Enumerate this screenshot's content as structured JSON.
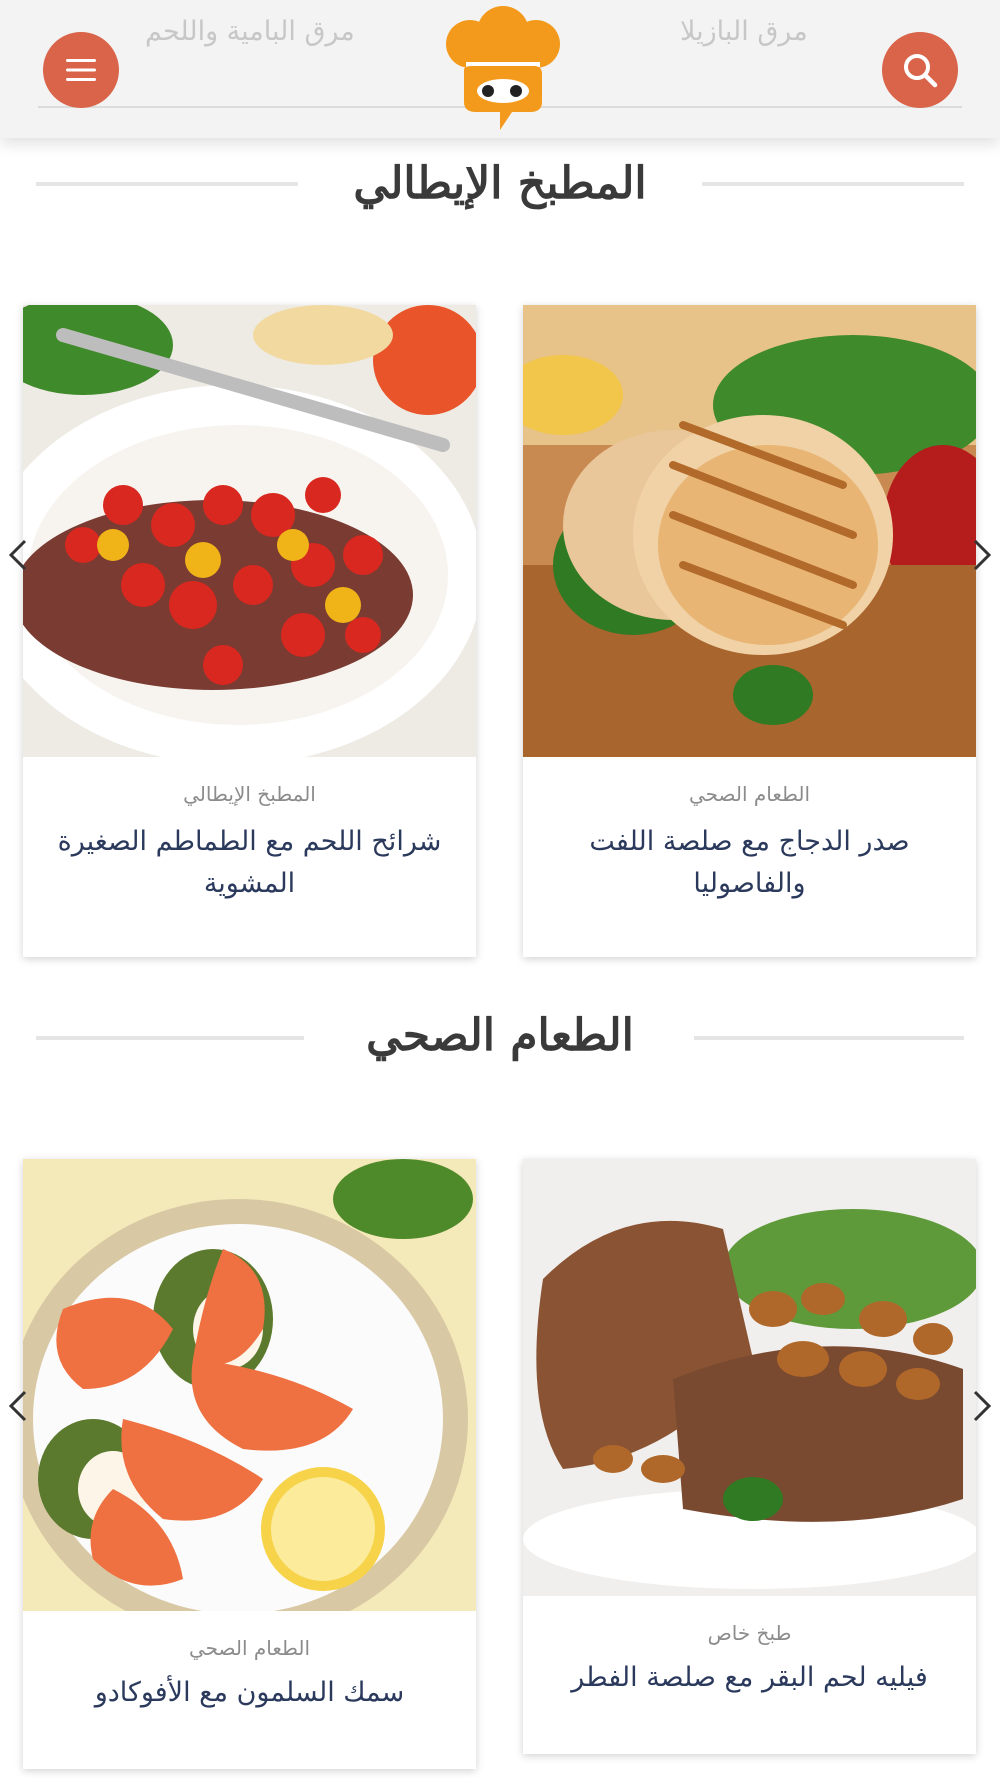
{
  "header": {
    "ghost_right": "مرق البازيلا",
    "ghost_left": "مرق البامية واللحم",
    "menu_icon": "hamburger-icon",
    "search_icon": "search-icon",
    "logo_icon": "chef-hat-logo",
    "accent_color": "#d9644a",
    "logo_color": "#f39a1c"
  },
  "sections": [
    {
      "title": "المطبخ الإيطالي",
      "cards": [
        {
          "category": "الطعام الصحي",
          "title_line1": "صدر الدجاج مع صلصة اللفت",
          "title_line2": "والفاصوليا"
        },
        {
          "category": "المطبخ الإيطالي",
          "title_line1": "شرائح اللحم مع الطماطم الصغيرة",
          "title_line2": "المشوية"
        }
      ]
    },
    {
      "title": "الطعام الصحي",
      "cards": [
        {
          "category": "طبخ خاص",
          "title_line1": "فيليه لحم البقر مع صلصة الفطر"
        },
        {
          "category": "الطعام الصحي",
          "title_line1": "سمك السلمون مع الأفوكادو"
        }
      ]
    }
  ],
  "carousel": {
    "prev_icon": "chevron-left-icon",
    "next_icon": "chevron-right-icon"
  }
}
